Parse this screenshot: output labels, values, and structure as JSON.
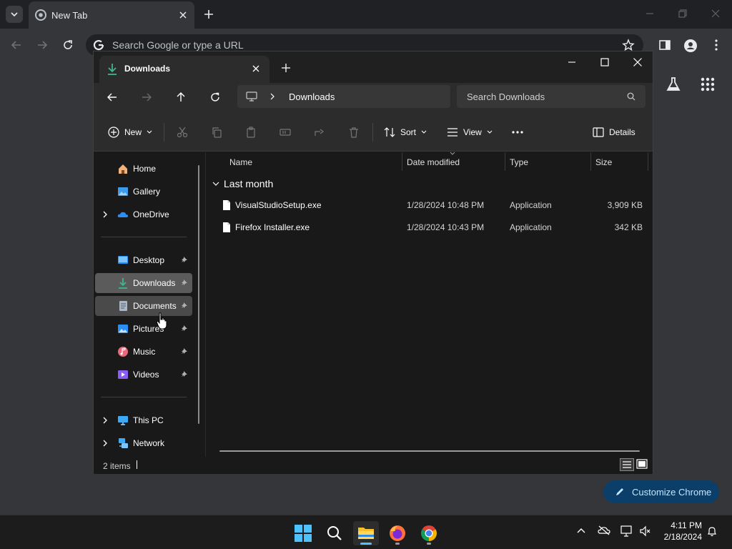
{
  "chrome": {
    "tab_title": "New Tab",
    "omnibox_placeholder": "Search Google or type a URL",
    "customize_label": "Customize Chrome"
  },
  "explorer": {
    "tab_title": "Downloads",
    "breadcrumb": "Downloads",
    "search_placeholder": "Search Downloads",
    "commands": {
      "new": "New",
      "sort": "Sort",
      "view": "View",
      "details": "Details"
    },
    "nav": {
      "home": "Home",
      "gallery": "Gallery",
      "onedrive": "OneDrive",
      "desktop": "Desktop",
      "downloads": "Downloads",
      "documents": "Documents",
      "pictures": "Pictures",
      "music": "Music",
      "videos": "Videos",
      "this_pc": "This PC",
      "network": "Network"
    },
    "columns": {
      "name": "Name",
      "date": "Date modified",
      "type": "Type",
      "size": "Size"
    },
    "group": "Last month",
    "files": [
      {
        "name": "VisualStudioSetup.exe",
        "date": "1/28/2024 10:48 PM",
        "type": "Application",
        "size": "3,909 KB"
      },
      {
        "name": "Firefox Installer.exe",
        "date": "1/28/2024 10:43 PM",
        "type": "Application",
        "size": "342 KB"
      }
    ],
    "status": "2 items"
  },
  "taskbar": {
    "time": "4:11 PM",
    "date": "2/18/2024"
  },
  "colors": {
    "accent": "#4cc2ff",
    "selection": "#5b5b5b",
    "chrome_frame": "#202124"
  }
}
